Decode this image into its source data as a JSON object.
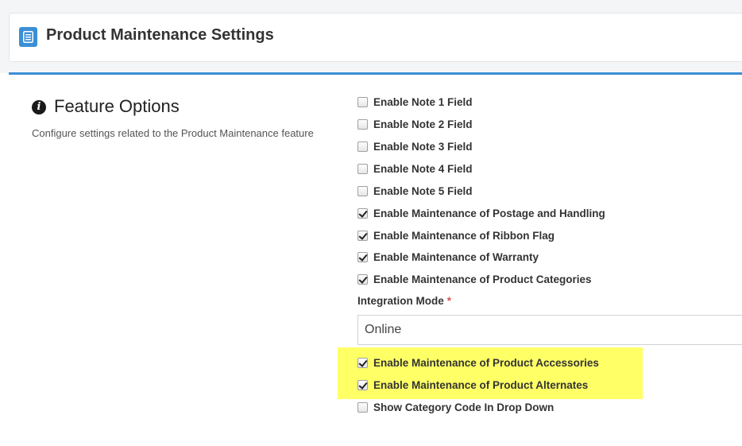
{
  "header": {
    "title": "Product Maintenance Settings",
    "icon": "document-list-icon"
  },
  "section": {
    "title": "Feature Options",
    "description": "Configure settings related to the Product Maintenance feature",
    "icon": "info-circle-icon"
  },
  "options_top": [
    {
      "label": "Enable Note 1 Field",
      "checked": false
    },
    {
      "label": "Enable Note 2 Field",
      "checked": false
    },
    {
      "label": "Enable Note 3 Field",
      "checked": false
    },
    {
      "label": "Enable Note 4 Field",
      "checked": false
    },
    {
      "label": "Enable Note 5 Field",
      "checked": false
    },
    {
      "label": "Enable Maintenance of Postage and Handling",
      "checked": true
    },
    {
      "label": "Enable Maintenance of Ribbon Flag",
      "checked": true
    },
    {
      "label": "Enable Maintenance of Warranty",
      "checked": true
    },
    {
      "label": "Enable Maintenance of Product Categories",
      "checked": true
    }
  ],
  "integration_mode": {
    "label": "Integration Mode",
    "required_mark": "*",
    "value": "Online"
  },
  "options_bottom": [
    {
      "label": "Enable Maintenance of Product Accessories",
      "checked": true
    },
    {
      "label": "Enable Maintenance of Product Alternates",
      "checked": true
    },
    {
      "label": "Show Category Code In Drop Down",
      "checked": false
    }
  ],
  "colors": {
    "accent": "#3b8fd6",
    "highlight": "#ffff66",
    "required": "#d9534f"
  }
}
